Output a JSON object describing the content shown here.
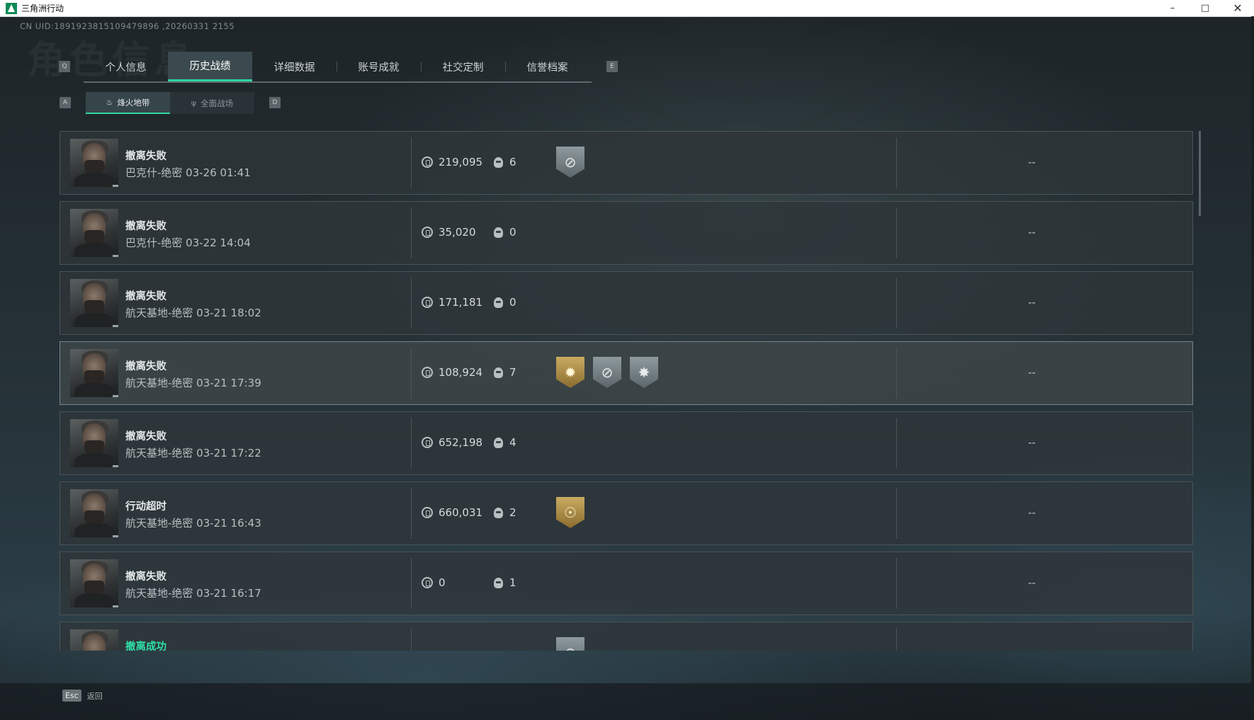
{
  "window": {
    "title": "三角洲行动",
    "minimize": "–",
    "maximize": "□",
    "close": "✕"
  },
  "uid": "CN UID:1891923815109479896 ,20260331 2155",
  "ghost_title": "角色信息",
  "keys": {
    "prev_tab": "Q",
    "next_tab": "E",
    "prev_sub": "A",
    "next_sub": "D"
  },
  "tabs": [
    {
      "label": "个人信息",
      "active": false
    },
    {
      "label": "历史战绩",
      "active": true
    },
    {
      "label": "详细数据",
      "active": false
    },
    {
      "label": "账号成就",
      "active": false
    },
    {
      "label": "社交定制",
      "active": false
    },
    {
      "label": "信誉档案",
      "active": false
    }
  ],
  "subtabs": [
    {
      "label": "烽火地带",
      "icon": "♨",
      "active": true
    },
    {
      "label": "全面战场",
      "icon": "ψ",
      "active": false
    }
  ],
  "records": [
    {
      "status": "撤离失败",
      "map": "巴克什-绝密 03-26 01:41",
      "money": "219,095",
      "kills": "6",
      "badges": [
        {
          "type": "silver",
          "icon": "⊘"
        }
      ],
      "extra": "--"
    },
    {
      "status": "撤离失败",
      "map": "巴克什-绝密 03-22 14:04",
      "money": "35,020",
      "kills": "0",
      "badges": [],
      "extra": "--"
    },
    {
      "status": "撤离失败",
      "map": "航天基地-绝密 03-21 18:02",
      "money": "171,181",
      "kills": "0",
      "badges": [],
      "extra": "--"
    },
    {
      "status": "撤离失败",
      "map": "航天基地-绝密 03-21 17:39",
      "money": "108,924",
      "kills": "7",
      "badges": [
        {
          "type": "gold",
          "icon": "✹"
        },
        {
          "type": "silver",
          "icon": "⊘"
        },
        {
          "type": "silver",
          "icon": "✸"
        }
      ],
      "extra": "--"
    },
    {
      "status": "撤离失败",
      "map": "航天基地-绝密 03-21 17:22",
      "money": "652,198",
      "kills": "4",
      "badges": [],
      "extra": "--"
    },
    {
      "status": "行动超时",
      "map": "航天基地-绝密 03-21 16:43",
      "money": "660,031",
      "kills": "2",
      "badges": [
        {
          "type": "gold",
          "icon": "☉"
        }
      ],
      "extra": "--"
    },
    {
      "status": "撤离失败",
      "map": "航天基地-绝密 03-21 16:17",
      "money": "0",
      "kills": "1",
      "badges": [],
      "extra": "--"
    },
    {
      "status": "撤离成功",
      "map": "",
      "money": "",
      "kills": "",
      "badges": [
        {
          "type": "silver",
          "icon": "⊘"
        }
      ],
      "extra": ""
    }
  ],
  "footer": {
    "esc_key": "Esc",
    "back_label": "返回"
  }
}
